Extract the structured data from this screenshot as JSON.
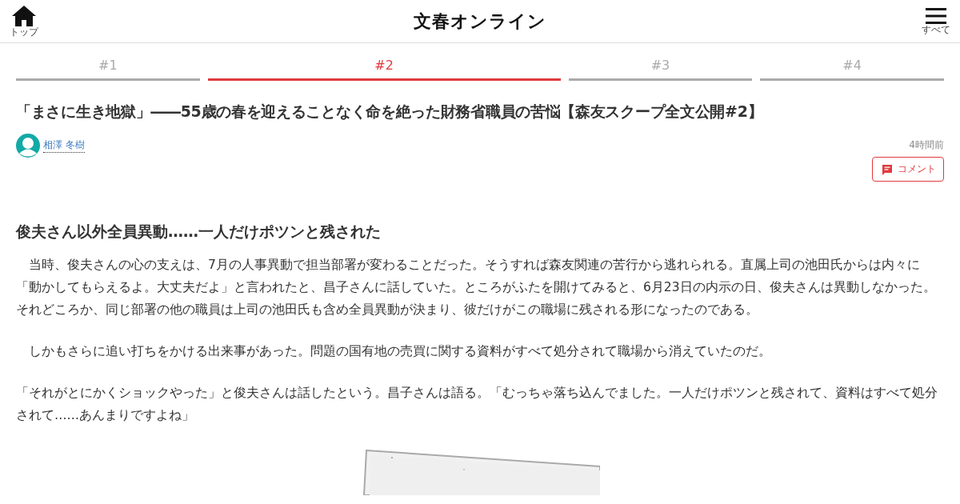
{
  "header": {
    "home_label": "トップ",
    "logo": "文春オンライン",
    "menu_label": "すべて"
  },
  "tabs": [
    {
      "label": "#1",
      "selected": false
    },
    {
      "label": "#2",
      "selected": true
    },
    {
      "label": "#3",
      "selected": false
    },
    {
      "label": "#4",
      "selected": false
    }
  ],
  "article": {
    "title": "「まさに生き地獄」――55歳の春を迎えることなく命を絶った財務省職員の苦悩【森友スクープ全文公開#2】",
    "author": "相澤 冬樹",
    "time": "4時間前",
    "comment_button": "コメント",
    "heading": "俊夫さん以外全員異動……一人だけポツンと残された",
    "paragraphs": [
      "　当時、俊夫さんの心の支えは、7月の人事異動で担当部署が変わることだった。そうすれば森友関連の苦行から逃れられる。直属上司の池田氏からは内々に「動かしてもらえるよ。大丈夫だよ」と言われたと、昌子さんに話していた。ところがふたを開けてみると、6月23日の内示の日、俊夫さんは異動しなかった。それどころか、同じ部署の他の職員は上司の池田氏も含め全員異動が決まり、彼だけがこの職場に残される形になったのである。",
      "　しかもさらに追い打ちをかける出来事があった。問題の国有地の売買に関する資料がすべて処分されて職場から消えていたのだ。",
      "「それがとにかくショックやった」と俊夫さんは話したという。昌子さんは語る。「むっちゃ落ち込んでました。一人だけポツンと残されて、資料はすべて処分されて……あんまりですよね」"
    ],
    "image": {
      "kind": "picture"
    }
  }
}
